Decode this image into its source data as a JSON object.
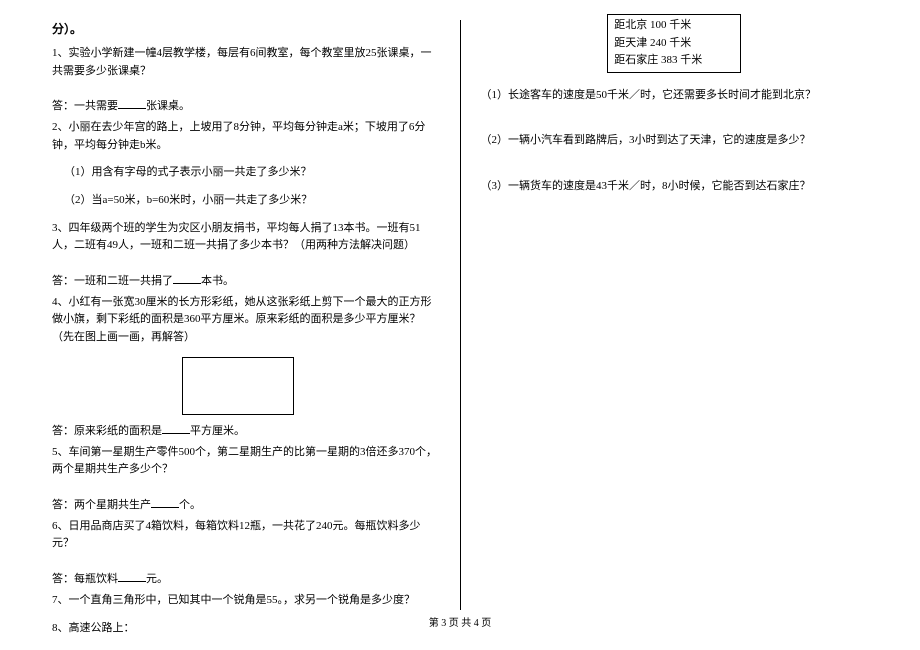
{
  "left": {
    "title": "分）。",
    "q1": "1、实验小学新建一幢4层教学楼，每层有6间教室，每个教室里放25张课桌，一共需要多少张课桌？",
    "a1_prefix": "答：一共需要",
    "a1_suffix": "张课桌。",
    "q2": "2、小丽在去少年宫的路上，上坡用了8分钟，平均每分钟走a米；下坡用了6分钟，平均每分钟走b米。",
    "q2_1": "（1）用含有字母的式子表示小丽一共走了多少米？",
    "q2_2": "（2）当a=50米，b=60米时，小丽一共走了多少米？",
    "q3": "3、四年级两个班的学生为灾区小朋友捐书，平均每人捐了13本书。一班有51人，二班有49人，一班和二班一共捐了多少本书？（用两种方法解决问题）",
    "a3_prefix": "答：一班和二班一共捐了",
    "a3_suffix": "本书。",
    "q4": "4、小红有一张宽30厘米的长方形彩纸，她从这张彩纸上剪下一个最大的正方形做小旗，剩下彩纸的面积是360平方厘米。原来彩纸的面积是多少平方厘米？（先在图上画一画，再解答）",
    "a4_prefix": "答：原来彩纸的面积是",
    "a4_suffix": "平方厘米。",
    "q5": "5、车间第一星期生产零件500个，第二星期生产的比第一星期的3倍还多370个，两个星期共生产多少个？",
    "a5_prefix": "答：两个星期共生产",
    "a5_suffix": "个。",
    "q6": "6、日用品商店买了4箱饮料，每箱饮料12瓶，一共花了240元。每瓶饮料多少元？",
    "a6_prefix": "答：每瓶饮料",
    "a6_suffix": "元。",
    "q7": "7、一个直角三角形中，已知其中一个锐角是55。，求另一个锐角是多少度？",
    "q8": "8、高速公路上："
  },
  "right": {
    "sign_line1": "距北京 100 千米",
    "sign_line2": "距天津 240 千米",
    "sign_line3": "距石家庄 383 千米",
    "r1": "（1）长途客车的速度是50千米／时，它还需要多长时间才能到北京？",
    "r2": "（2）一辆小汽车看到路牌后，3小时到达了天津，它的速度是多少？",
    "r3": "（3）一辆货车的速度是43千米／时，8小时候，它能否到达石家庄？"
  },
  "footer": "第 3 页 共 4 页"
}
